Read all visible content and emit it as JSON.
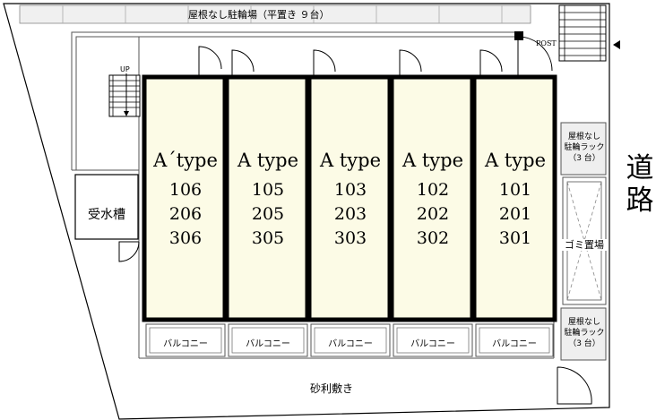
{
  "bike_parking_top": "屋根なし駐輪場（平置き ９台）",
  "up_label": "UP",
  "post_label": "POST",
  "water_tank": "受水槽",
  "gravel": "砂利敷き",
  "road": [
    "道",
    "路"
  ],
  "garbage": "ゴミ置場",
  "bike_rack_upper": [
    "屋根なし",
    "駐輪ラック",
    "（3 台）"
  ],
  "bike_rack_lower": [
    "屋根なし",
    "駐輪ラック",
    "（3 台）"
  ],
  "units": [
    {
      "type": "A´type",
      "rooms": [
        "106",
        "206",
        "306"
      ],
      "balcony": "バルコニー"
    },
    {
      "type": "A type",
      "rooms": [
        "105",
        "205",
        "305"
      ],
      "balcony": "バルコニー"
    },
    {
      "type": "A type",
      "rooms": [
        "103",
        "203",
        "303"
      ],
      "balcony": "バルコニー"
    },
    {
      "type": "A type",
      "rooms": [
        "102",
        "202",
        "302"
      ],
      "balcony": "バルコニー"
    },
    {
      "type": "A type",
      "rooms": [
        "101",
        "201",
        "301"
      ],
      "balcony": "バルコニー"
    }
  ],
  "colors": {
    "unit_fill": "#fcfbe6",
    "line": "#000000",
    "bike_band": "#f0f0f0",
    "rack_fill": "#efefef"
  }
}
